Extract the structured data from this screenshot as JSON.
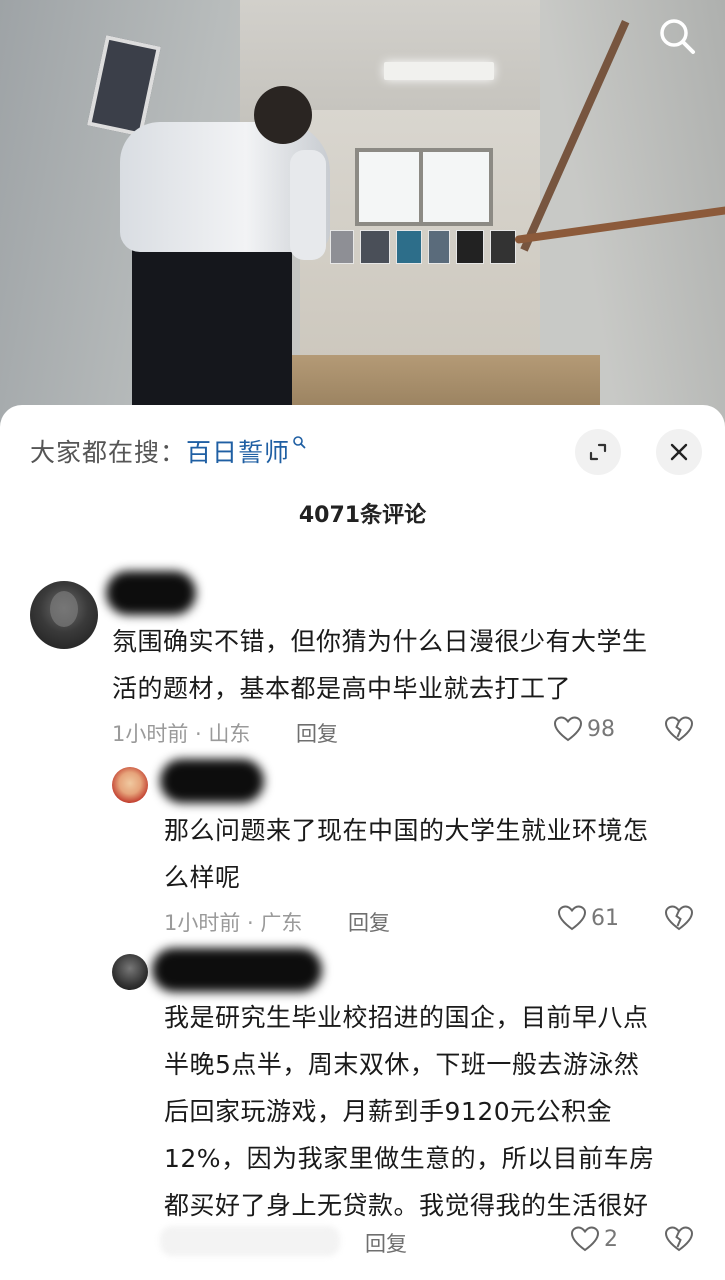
{
  "search": {
    "icon": "search-icon"
  },
  "sheet": {
    "hot_search_label": "大家都在搜：",
    "hot_search_keyword": "百日誓师",
    "comment_count": "4071条评论"
  },
  "comments": [
    {
      "text_line1": "氛围确实不错，但你猜为什么日漫很少有大学生",
      "text_line2": "活的题材，基本都是高中毕业就去打工了",
      "time_location": "1小时前 · 山东",
      "reply_label": "回复",
      "likes": "98"
    },
    {
      "text_line1": "那么问题来了现在中国的大学生就业环境怎",
      "text_line2": "么样呢",
      "time_location": "1小时前 · 广东",
      "reply_label": "回复",
      "likes": "61"
    },
    {
      "text_line1": "我是研究生毕业校招进的国企，目前早八点",
      "text_line2": "半晚5点半，周末双休，下班一般去游泳然",
      "text_line3": "后回家玩游戏，月薪到手9120元公积金",
      "text_line4": "12%，因为我家里做生意的，所以目前车房",
      "text_line5": "都买好了身上无贷款。我觉得我的生活很好",
      "reply_label": "回复",
      "likes": "2"
    }
  ],
  "colors": {
    "keyword": "#1f5fa3",
    "meta": "#9a9a9a"
  }
}
